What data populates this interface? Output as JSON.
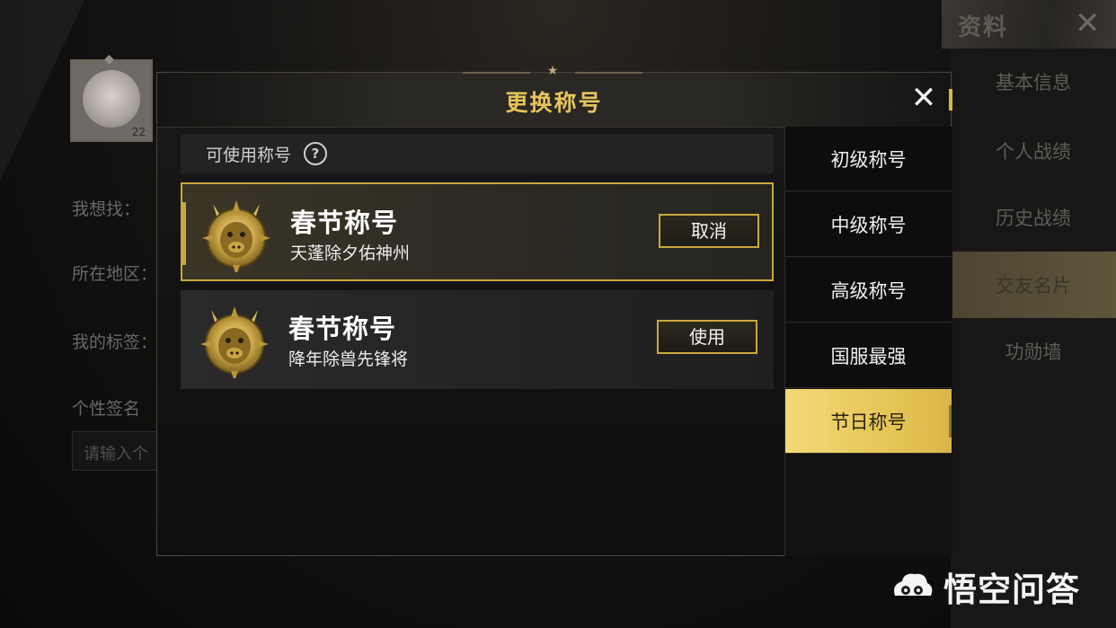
{
  "background": {
    "avatar_level": "22",
    "labels": [
      "我想找：",
      "所在地区：",
      "我的标签：",
      "个性签名"
    ],
    "signature_placeholder": "请输入个",
    "right_panel": {
      "title": "资料",
      "items": [
        {
          "label": "基本信息"
        },
        {
          "label": "个人战绩"
        },
        {
          "label": "历史战绩"
        },
        {
          "label": "交友名片"
        },
        {
          "label": "功勋墙"
        }
      ]
    }
  },
  "modal": {
    "title": "更换称号",
    "list_header": "可使用称号",
    "rows": [
      {
        "name": "春节称号",
        "subtitle": "天蓬除夕佑神州",
        "button": "取消",
        "selected": true
      },
      {
        "name": "春节称号",
        "subtitle": "降年除兽先锋将",
        "button": "使用",
        "selected": false
      }
    ],
    "categories": [
      {
        "label": "初级称号"
      },
      {
        "label": "中级称号"
      },
      {
        "label": "高级称号"
      },
      {
        "label": "国服最强"
      },
      {
        "label": "节日称号"
      }
    ],
    "active_category": "节日称号"
  },
  "watermark": {
    "text": "悟空问答"
  },
  "colors": {
    "accent_gold": "#e6c45c",
    "button_border": "#c9a93e",
    "active_tab": "#f2d977"
  }
}
